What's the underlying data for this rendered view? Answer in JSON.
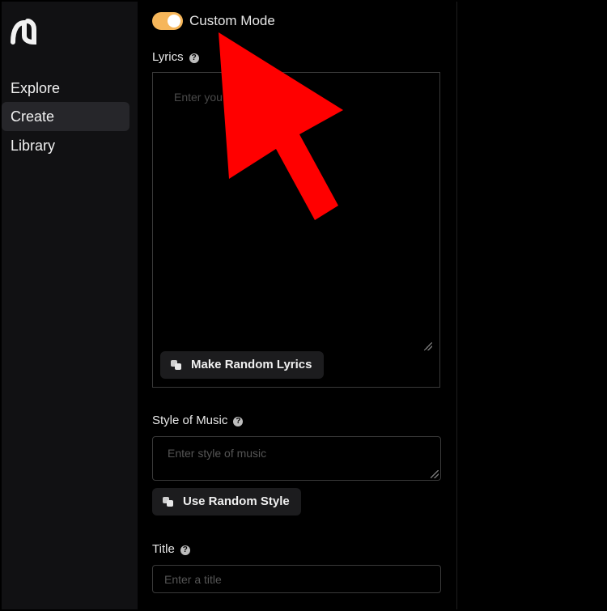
{
  "sidebar": {
    "items": [
      {
        "label": "Explore",
        "active": false
      },
      {
        "label": "Create",
        "active": true
      },
      {
        "label": "Library",
        "active": false
      }
    ]
  },
  "custom_mode": {
    "label": "Custom Mode",
    "enabled": true,
    "toggle_color": "#f6b65a"
  },
  "lyrics": {
    "label": "Lyrics",
    "placeholder_visible": "Enter you",
    "random_button": "Make Random Lyrics"
  },
  "style": {
    "label": "Style of Music",
    "placeholder": "Enter style of music",
    "random_button": "Use Random Style"
  },
  "title": {
    "label": "Title",
    "placeholder": "Enter a title"
  },
  "annotation": {
    "arrow_color": "#ff0000",
    "icon": "pointer-arrow-icon"
  }
}
